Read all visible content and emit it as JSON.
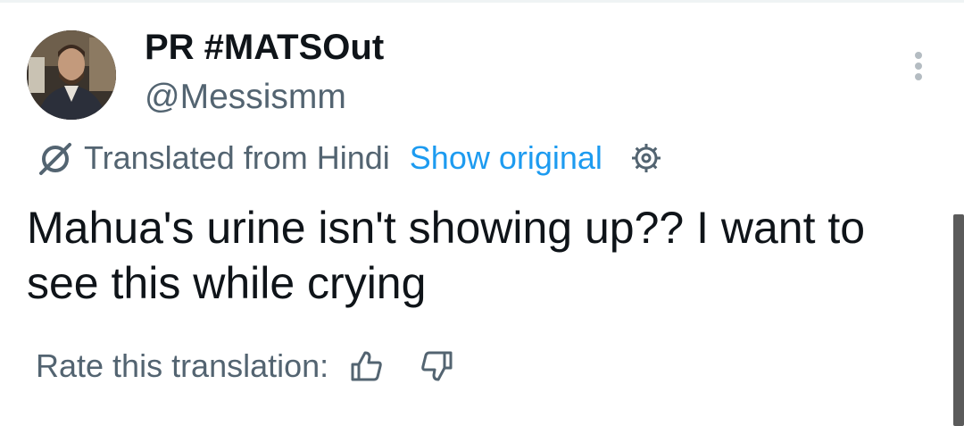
{
  "tweet": {
    "display_name": "PR #MATSOut",
    "handle": "@Messismm",
    "translation": {
      "label": "Translated from Hindi",
      "show_original": "Show original"
    },
    "text": "Mahua's urine isn't showing up?? I want to see this while crying",
    "rate": {
      "label": "Rate this translation:"
    }
  },
  "colors": {
    "primary_text": "#0f1419",
    "secondary_text": "#536471",
    "link": "#1d9bf0",
    "scrollbar": "#5b5b5b"
  },
  "icons": {
    "more": "more-vertical-icon",
    "translate": "translate-icon",
    "settings": "gear-icon",
    "rate_up": "thumbs-up-icon",
    "rate_down": "thumbs-down-icon"
  }
}
